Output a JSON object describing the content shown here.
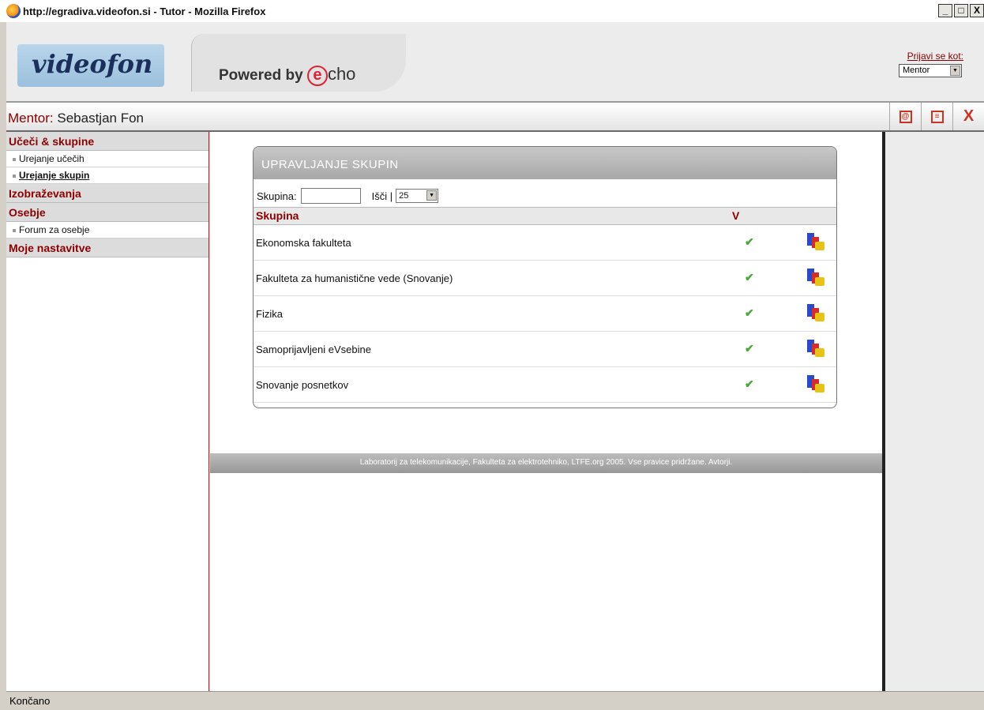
{
  "window": {
    "title": "http://egradiva.videofon.si - Tutor - Mozilla Firefox",
    "minimize": "_",
    "maximize": "□",
    "close": "X"
  },
  "header": {
    "logo_text": "videofon",
    "powered_label": "Powered by",
    "powered_brand": "cho",
    "login_label": "Prijavi se kot:",
    "login_role": "Mentor"
  },
  "mentorbar": {
    "label": "Mentor:",
    "name": "Sebastjan Fon"
  },
  "sidebar": {
    "section1": "Učeči & skupine",
    "item1": "Urejanje učečih",
    "item2": "Urejanje skupin",
    "section2": "Izobraževanja",
    "section3": "Osebje",
    "item3": "Forum za osebje",
    "section4": "Moje nastavitve"
  },
  "panel": {
    "title": "UPRAVLJANJE SKUPIN",
    "filter_label": "Skupina:",
    "search_label": "Išči |",
    "page_size": "25",
    "col_group": "Skupina",
    "col_v": "V",
    "rows": [
      {
        "name": "Ekonomska fakulteta",
        "check": "✔"
      },
      {
        "name": "Fakulteta za humanistične vede (Snovanje)",
        "check": "✔"
      },
      {
        "name": "Fizika",
        "check": "✔"
      },
      {
        "name": "Samoprijavljeni eVsebine",
        "check": "✔"
      },
      {
        "name": "Snovanje posnetkov",
        "check": "✔"
      }
    ]
  },
  "footer": "Laboratorij za telekomunikacije, Fakulteta za elektrotehniko, LTFE.org 2005. Vse pravice pridržane. Avtorji.",
  "status": "Končano"
}
